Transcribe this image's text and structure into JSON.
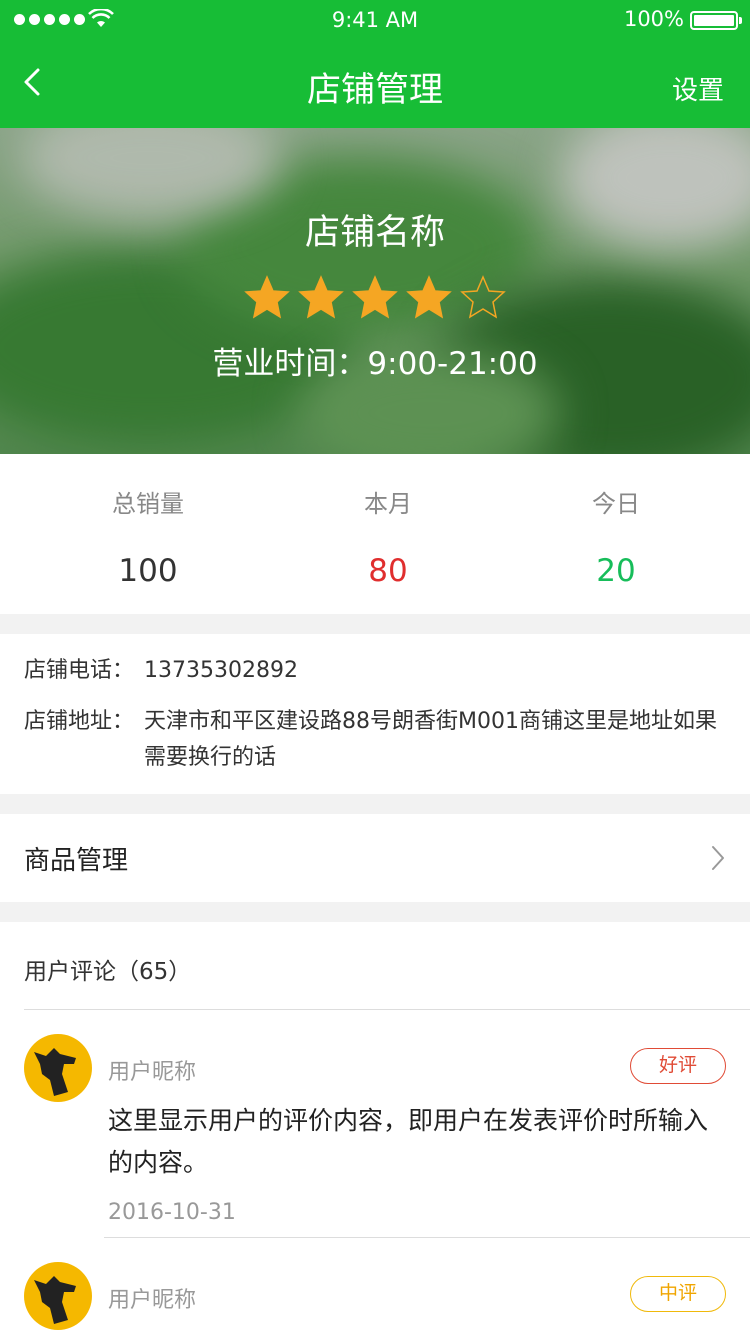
{
  "status_bar": {
    "time": "9:41 AM",
    "battery": "100%"
  },
  "navbar": {
    "title": "店铺管理",
    "settings_label": "设置"
  },
  "hero": {
    "shop_name": "店铺名称",
    "rating": 4,
    "rating_max": 5,
    "hours_label": "营业时间：",
    "hours": "9:00-21:00"
  },
  "stats": [
    {
      "label": "总销量",
      "value": "100",
      "color": "#333333"
    },
    {
      "label": "本月",
      "value": "80",
      "color": "#e02e2e"
    },
    {
      "label": "今日",
      "value": "20",
      "color": "#17bd5a"
    }
  ],
  "info": {
    "phone_label": "店铺电话：",
    "phone": "13735302892",
    "address_label": "店铺地址：",
    "address": "天津市和平区建设路88号朗香街M001商铺这里是地址如果需要换行的话"
  },
  "goods": {
    "label": "商品管理"
  },
  "reviews": {
    "title": "用户评论（65）",
    "items": [
      {
        "nickname": "用户昵称",
        "badge": "好评",
        "content": "这里显示用户的评价内容，即用户在发表评价时所输入的内容。",
        "date": "2016-10-31"
      },
      {
        "nickname": "用户昵称",
        "badge": "中评"
      }
    ]
  },
  "colors": {
    "brand": "#17bd36",
    "star": "#f5a623",
    "good": "#e04b36",
    "mid": "#f0b90b"
  }
}
